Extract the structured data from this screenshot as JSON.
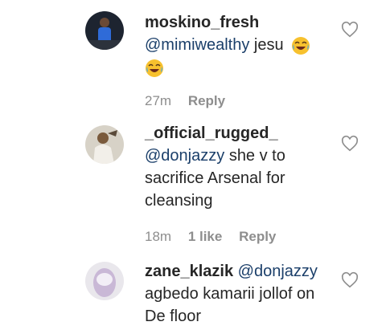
{
  "comments": [
    {
      "username": "moskino_fresh",
      "mention": "@mimiwealthy",
      "text": "jesu",
      "emoji": "face-with-tears-of-joy",
      "time": "27m",
      "likes": "",
      "reply_label": "Reply"
    },
    {
      "username": "_official_rugged_",
      "mention": "@donjazzy",
      "text": "she v to sacrifice Arsenal for cleansing",
      "time": "18m",
      "likes": "1 like",
      "reply_label": "Reply"
    },
    {
      "username": "zane_klazik",
      "mention": "@donjazzy",
      "text": "agbedo kamarii jollof on De floor"
    }
  ],
  "colors": {
    "text": "#262626",
    "mention": "#1b3f6a",
    "meta": "#8e8e8e"
  },
  "icons": [
    "heart-outline-icon",
    "face-with-tears-of-joy-emoji"
  ]
}
